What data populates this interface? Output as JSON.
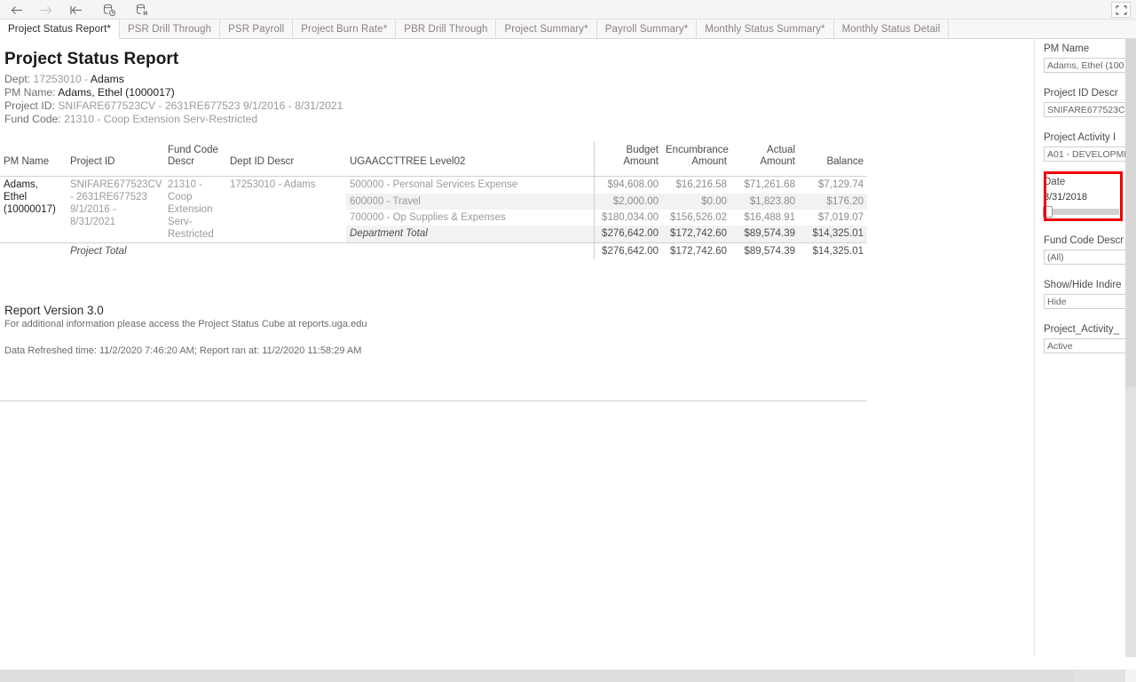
{
  "toolbar": {
    "buttons": [
      {
        "name": "back-button",
        "icon": "arrow-left-icon",
        "enabled": true
      },
      {
        "name": "forward-button",
        "icon": "arrow-right-icon",
        "enabled": false
      },
      {
        "name": "revert-button",
        "icon": "revert-to-start-icon",
        "enabled": true
      },
      {
        "name": "refresh-button",
        "icon": "refresh-data-source-icon",
        "enabled": true
      },
      {
        "name": "pause-button",
        "icon": "pause-auto-update-icon",
        "enabled": true
      }
    ],
    "fullscreen_icon": "fullscreen-icon"
  },
  "tabs": [
    {
      "label": "Project Status Report*",
      "active": true
    },
    {
      "label": "PSR Drill Through",
      "active": false
    },
    {
      "label": "PSR Payroll",
      "active": false
    },
    {
      "label": "Project Burn Rate*",
      "active": false
    },
    {
      "label": "PBR Drill Through",
      "active": false
    },
    {
      "label": "Project Summary*",
      "active": false
    },
    {
      "label": "Payroll Summary*",
      "active": false
    },
    {
      "label": "Monthly Status Summary*",
      "active": false
    },
    {
      "label": "Monthly Status Detail",
      "active": false
    }
  ],
  "report": {
    "title": "Project Status Report",
    "meta": {
      "dept_label": "Dept:",
      "dept_code": "17253010 -",
      "dept_name": "Adams",
      "pm_label": "PM Name:",
      "pm_value": "Adams, Ethel (1000017)",
      "project_label": "Project ID:",
      "project_value": "SNIFARE677523CV - 2631RE677523 9/1/2016 - 8/31/2021",
      "fund_label": "Fund Code:",
      "fund_value": "21310 - Coop Extension Serv-Restricted"
    }
  },
  "table": {
    "headers": {
      "pm_name": "PM Name",
      "project_id": "Project ID",
      "fund_code_descr": "Fund Code Descr",
      "dept_id_descr": "Dept ID Descr",
      "ugaaccttree": "UGAACCTTREE Level02",
      "budget_amount": "Budget Amount",
      "encumbrance_amount": "Encumbrance Amount",
      "actual_amount": "Actual Amount",
      "balance": "Balance"
    },
    "group": {
      "pm_name": "Adams, Ethel (10000017)",
      "project_id": "SNIFARE677523CV - 2631RE677523 9/1/2016 - 8/31/2021",
      "fund_code_descr": "21310 - Coop Extension Serv-Restricted",
      "dept_id_descr": "17253010 - Adams"
    },
    "rows": [
      {
        "account": "500000 - Personal Services Expense",
        "budget": "$94,608.00",
        "encumbrance": "$16,216.58",
        "actual": "$71,261.68",
        "balance": "$7,129.74"
      },
      {
        "account": "600000 - Travel",
        "budget": "$2,000.00",
        "encumbrance": "$0.00",
        "actual": "$1,823.80",
        "balance": "$176.20"
      },
      {
        "account": "700000 - Op Supplies & Expenses",
        "budget": "$180,034.00",
        "encumbrance": "$156,526.02",
        "actual": "$16,488.91",
        "balance": "$7,019.07"
      }
    ],
    "department_total": {
      "account": "Department Total",
      "budget": "$276,642.00",
      "encumbrance": "$172,742.60",
      "actual": "$89,574.39",
      "balance": "$14,325.01"
    },
    "project_total": {
      "label": "Project Total",
      "budget": "$276,642.00",
      "encumbrance": "$172,742.60",
      "actual": "$89,574.39",
      "balance": "$14,325.01"
    }
  },
  "footer": {
    "version": "Report Version 3.0",
    "info": "For additional information please access the Project Status Cube at reports.uga.edu",
    "refreshed": "Data Refreshed time: 11/2/2020 7:46:20 AM; Report ran at: 11/2/2020 11:58:29 AM"
  },
  "filters": [
    {
      "label": "PM Name",
      "value": "Adams, Ethel (100",
      "type": "dropdown"
    },
    {
      "label": "Project ID Descr",
      "value": "SNIFARE677523C",
      "type": "dropdown"
    },
    {
      "label": "Project Activity I",
      "value": "A01 - DEVELOPME",
      "type": "dropdown"
    },
    {
      "label": "Date",
      "value": "3/31/2018",
      "type": "slider",
      "highlighted": true
    },
    {
      "label": "Fund Code Descr",
      "value": "(All)",
      "type": "dropdown"
    },
    {
      "label": "Show/Hide Indire",
      "value": "Hide",
      "type": "dropdown"
    },
    {
      "label": "Project_Activity_",
      "value": "Active",
      "type": "dropdown"
    }
  ],
  "colors": {
    "highlight_red": "#ee0000",
    "tab_active_text": "#2b2b2b",
    "tab_inactive_text": "#8a7f86"
  }
}
